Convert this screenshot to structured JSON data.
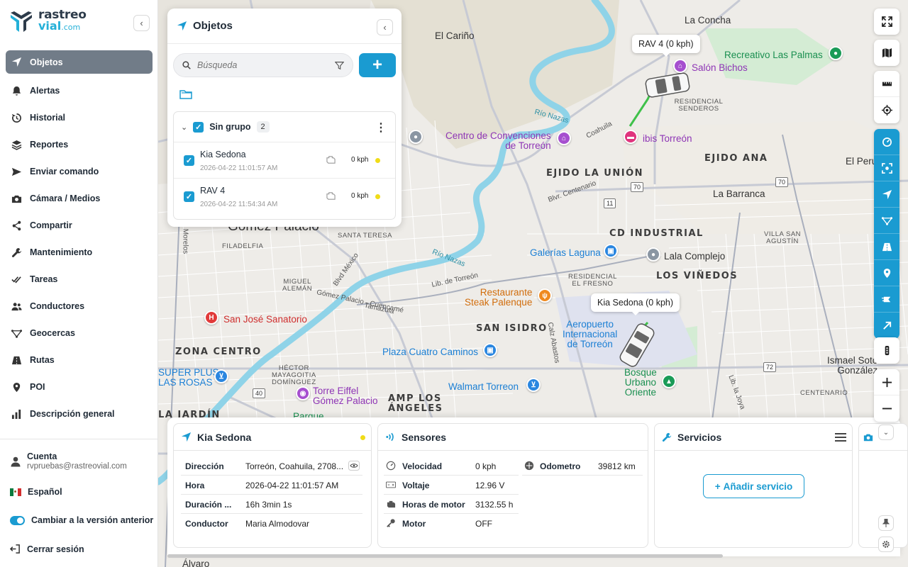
{
  "brand": {
    "line1": "rastreo",
    "line2": "vial",
    "line2_suffix": ".com",
    "accent": "#1a9bd1",
    "dark": "#2d3b4a"
  },
  "sidebar": {
    "items": [
      {
        "label": "Objetos",
        "icon": "navigation-arrow-icon",
        "active": true
      },
      {
        "label": "Alertas",
        "icon": "bell-icon"
      },
      {
        "label": "Historial",
        "icon": "history-icon"
      },
      {
        "label": "Reportes",
        "icon": "layers-icon"
      },
      {
        "label": "Enviar comando",
        "icon": "send-icon"
      },
      {
        "label": "Cámara / Medios",
        "icon": "camera-icon"
      },
      {
        "label": "Compartir",
        "icon": "share-icon"
      },
      {
        "label": "Mantenimiento",
        "icon": "wrench-icon"
      },
      {
        "label": "Tareas",
        "icon": "double-check-icon"
      },
      {
        "label": "Conductores",
        "icon": "users-icon"
      },
      {
        "label": "Geocercas",
        "icon": "geofence-icon"
      },
      {
        "label": "Rutas",
        "icon": "road-icon"
      },
      {
        "label": "POI",
        "icon": "map-pin-icon"
      },
      {
        "label": "Descripción general",
        "icon": "bar-chart-icon"
      }
    ],
    "account": {
      "label": "Cuenta",
      "email": "rvpruebas@rastreovial.com"
    },
    "language": "Español",
    "old_version": "Cambiar a la versión anterior",
    "logout": "Cerrar sesión"
  },
  "objects_panel": {
    "title": "Objetos",
    "search_placeholder": "Búsqueda",
    "group": {
      "name": "Sin grupo",
      "count": "2"
    },
    "objects": [
      {
        "name": "Kia Sedona",
        "time": "2026-04-22 11:01:57 AM",
        "speed": "0 kph"
      },
      {
        "name": "RAV 4",
        "time": "2026-04-22 11:54:34 AM",
        "speed": "0 kph"
      }
    ]
  },
  "map": {
    "labels": {
      "el_carino": "El Cariño",
      "la_concha": "La Concha",
      "recreativo": "Recreativo Las Palmas",
      "salon": "Salón Bichos",
      "residencial_senderos": "RESIDENCIAL SENDEROS",
      "centro_conv": "Centro de Convenciones\nde Torreón",
      "ibis": "ibis Torreón",
      "ejido_ana": "EJIDO ANA",
      "el_peru": "El Peru",
      "ejido_union": "EJIDO LA UNIÓN",
      "la_barranca": "La Barranca",
      "rio_nazas_1": "Río Nazas",
      "rio_nazas_2": "Río Nazas",
      "coahuila": "Coahuila",
      "blvd_centenario": "Blvr. Centenario",
      "gomez_palacio": "Gómez Palacio",
      "santa_teresa": "SANTA TERESA",
      "filadelfia": "FILADELFIA",
      "cd_industrial": "CD INDUSTRIAL",
      "villa_san_agustin": "VILLA SAN\nAGUSTÍN",
      "galerias": "Galerías Laguna",
      "lala": "Lala Complejo",
      "los_vinedos": "LOS VIÑEDOS",
      "residencial_fresno": "RESIDENCIAL\nEL FRESNO",
      "miguel_aleman": "MIGUEL\nALEMÁN",
      "blvd_mexico": "Blvd México",
      "gp_cuencame": "Gómez Palacio - Cuencamé",
      "lib_torreon": "Lib. de Torreón",
      "tamazula": "Tamazula",
      "restaurante": "Restaurante\nSteak Palenque",
      "aeropuerto": "Aeropuerto\nInternacional\nde Torreón",
      "san_jose": "San José Sanatorio",
      "san_isidro": "SAN ISIDRO",
      "calz_abastos": "Calz Abastos",
      "zona_centro": "ZONA CENTRO",
      "plaza_cuatro": "Plaza Cuatro Caminos",
      "super_plus": "SUPER PLUS\nLAS ROSAS",
      "hector": "HÉCTOR\nMAYAGOITIA\nDOMÍNGUEZ",
      "torre_eiffel": "Torre Eiffel\nGómez Palacio",
      "walmart": "Walmart Torreon",
      "amp_angeles": "AMP LOS\nÁNGELES",
      "bosque": "Bosque\nUrbano\nOriente",
      "ismael": "Ismael Soto\nGonzález",
      "morelos": "Morelos",
      "centenario": "CENTENARIO",
      "la_jardin": "LA JARDÍN",
      "alvaro": "Álvaro",
      "parque": "Parque",
      "lib_la_joya": "Lib. la Joya"
    },
    "shields": [
      "70",
      "70",
      "11",
      "40",
      "72"
    ],
    "vehicle_tags": {
      "rav4": "RAV 4 (0 kph)",
      "kia": "Kia Sedona (0 kph)"
    }
  },
  "details": {
    "object_card": {
      "title": "Kia Sedona",
      "rows": [
        {
          "k": "Dirección",
          "v": "Torreón, Coahuila, 2708..."
        },
        {
          "k": "Hora",
          "v": "2026-04-22 11:01:57 AM"
        },
        {
          "k": "Duración ...",
          "v": "16h 3min 1s"
        },
        {
          "k": "Conductor",
          "v": "Maria Almodovar"
        }
      ]
    },
    "sensors_card": {
      "title": "Sensores",
      "rows": [
        {
          "k": "Velocidad",
          "v": "0 kph"
        },
        {
          "k": "Voltaje",
          "v": "12.96 V"
        },
        {
          "k": "Horas de motor",
          "v": "3132.55 h"
        },
        {
          "k": "Motor",
          "v": "OFF"
        }
      ],
      "odometer": {
        "k": "Odometro",
        "v": "39812 km"
      }
    },
    "services_card": {
      "title": "Servicios",
      "add_label": "Añadir servicio"
    }
  },
  "colors": {
    "status_dot": "#f0dc18",
    "route": "#3fc14a",
    "river": "#8fd3e8"
  }
}
